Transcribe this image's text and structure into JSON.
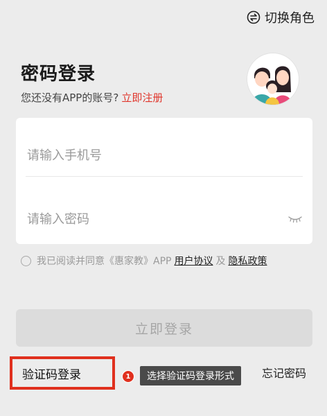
{
  "header": {
    "switch_role_label": "切换角色",
    "switch_icon": "swap-circle-icon"
  },
  "login": {
    "title": "密码登录",
    "signup_prompt": "您还没有APP的账号?",
    "signup_link": "立即注册"
  },
  "avatar": {
    "icon": "family-avatar-icon"
  },
  "form": {
    "phone_value": "",
    "phone_placeholder": "请输入手机号",
    "password_value": "",
    "password_placeholder": "请输入密码",
    "eye_icon": "eye-closed-icon"
  },
  "agreement": {
    "text": "我已阅读并同意《惠家教》APP",
    "user_agreement": "用户协议",
    "and": "及",
    "privacy_policy": "隐私政策"
  },
  "actions": {
    "login_button": "立即登录",
    "code_login": "验证码登录",
    "forgot_password": "忘记密码"
  },
  "annotation": {
    "step": "1",
    "tooltip": "选择验证码登录形式"
  },
  "colors": {
    "accent_red": "#e0362c",
    "highlight_border": "#e0301e",
    "disabled_button": "#dcdcdc",
    "background": "#ececec"
  }
}
